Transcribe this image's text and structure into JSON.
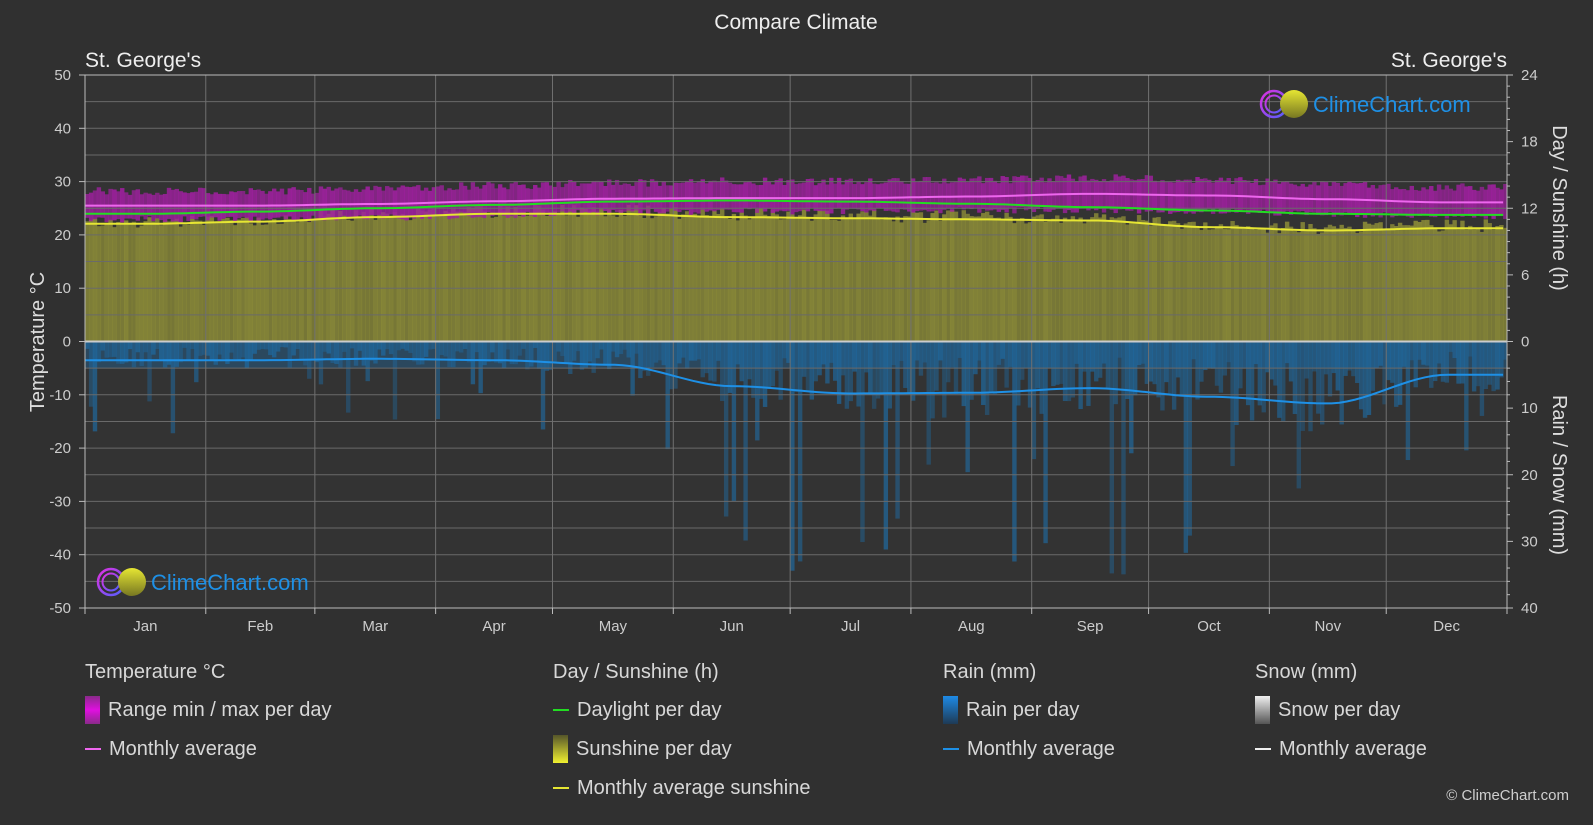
{
  "chart_data": {
    "type": "area",
    "title": "Compare Climate",
    "location_left": "St. George's",
    "location_right": "St. George's",
    "watermark": "ClimeChart.com",
    "categories": [
      "Jan",
      "Feb",
      "Mar",
      "Apr",
      "May",
      "Jun",
      "Jul",
      "Aug",
      "Sep",
      "Oct",
      "Nov",
      "Dec"
    ],
    "axes": {
      "left": {
        "label": "Temperature °C",
        "range": [
          -50,
          50
        ],
        "ticks": [
          50,
          40,
          30,
          20,
          10,
          0,
          -10,
          -20,
          -30,
          -40,
          -50
        ]
      },
      "right_top": {
        "label": "Day / Sunshine (h)",
        "range": [
          0,
          24
        ],
        "ticks": [
          24,
          18,
          12,
          6,
          0
        ]
      },
      "right_bottom": {
        "label": "Rain / Snow (mm)",
        "range": [
          0,
          40
        ],
        "ticks": [
          0,
          10,
          20,
          30,
          40
        ]
      }
    },
    "grid": true,
    "series": [
      {
        "name": "Temperature monthly average",
        "unit": "°C",
        "color": "#ee66ee",
        "values": [
          25.5,
          25.5,
          25.8,
          26.3,
          26.8,
          26.9,
          26.9,
          27.2,
          27.7,
          27.4,
          26.7,
          26.1
        ]
      },
      {
        "name": "Temperature range max per day",
        "unit": "°C",
        "color": "#a020a0",
        "values": [
          27.5,
          27.5,
          28.0,
          28.5,
          29.0,
          29.3,
          29.3,
          29.5,
          30.0,
          29.5,
          28.8,
          28.2
        ]
      },
      {
        "name": "Temperature range min per day",
        "unit": "°C",
        "color": "#a020a0",
        "values": [
          23.5,
          23.5,
          23.8,
          24.3,
          24.8,
          25.0,
          25.0,
          25.2,
          25.3,
          25.0,
          24.5,
          24.0
        ]
      },
      {
        "name": "Daylight per day",
        "unit": "h",
        "color": "#22dd22",
        "values": [
          11.5,
          11.7,
          12.0,
          12.3,
          12.6,
          12.7,
          12.6,
          12.4,
          12.1,
          11.8,
          11.5,
          11.4
        ]
      },
      {
        "name": "Monthly average sunshine",
        "unit": "h",
        "color": "#e6e633",
        "values": [
          10.6,
          10.8,
          11.2,
          11.5,
          11.5,
          11.2,
          11.1,
          11.0,
          10.9,
          10.3,
          10.0,
          10.2
        ]
      },
      {
        "name": "Rain monthly average",
        "unit": "mm",
        "color": "#1e90e6",
        "values": [
          2.8,
          2.8,
          2.6,
          2.8,
          3.5,
          6.7,
          7.8,
          7.7,
          7.0,
          8.3,
          9.3,
          5.0
        ]
      }
    ]
  },
  "legend": {
    "groups": [
      {
        "title": "Temperature °C",
        "items": [
          {
            "label": "Range min / max per day",
            "kind": "bar",
            "color": "#e020e0"
          },
          {
            "label": "Monthly average",
            "kind": "line",
            "color": "#ee66ee"
          }
        ]
      },
      {
        "title": "Day / Sunshine (h)",
        "items": [
          {
            "label": "Daylight per day",
            "kind": "line",
            "color": "#22dd22"
          },
          {
            "label": "Sunshine per day",
            "kind": "bar",
            "color": "#e6e633"
          },
          {
            "label": "Monthly average sunshine",
            "kind": "line",
            "color": "#e6e633"
          }
        ]
      },
      {
        "title": "Rain (mm)",
        "items": [
          {
            "label": "Rain per day",
            "kind": "bar",
            "color": "#1e8ae6"
          },
          {
            "label": "Monthly average",
            "kind": "line",
            "color": "#1e90e6"
          }
        ]
      },
      {
        "title": "Snow (mm)",
        "items": [
          {
            "label": "Snow per day",
            "kind": "bar",
            "color": "#dddddd"
          },
          {
            "label": "Monthly average",
            "kind": "line",
            "color": "#eeeeee"
          }
        ]
      }
    ]
  },
  "copyright": "© ClimeChart.com"
}
